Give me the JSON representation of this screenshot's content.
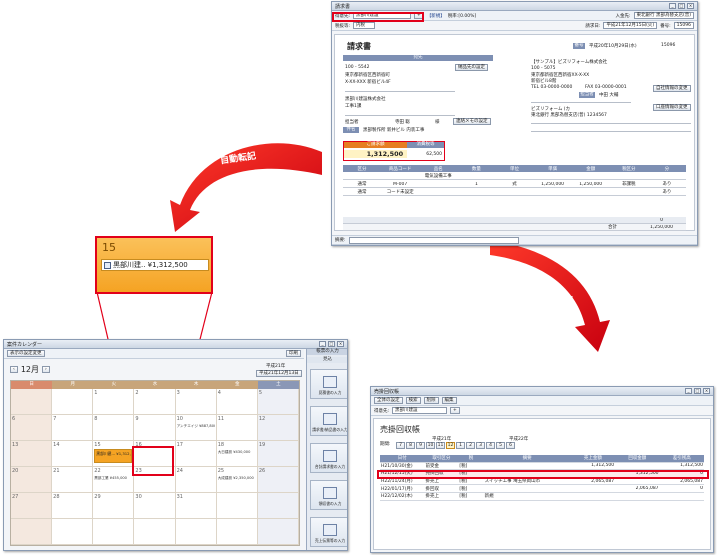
{
  "arrow_label": "自動転記",
  "colors": {
    "accent_red": "#e2001a",
    "header_blue": "#7d8fb3",
    "calendar_orange": "#f5a323"
  },
  "invoice": {
    "window_title": "請求書",
    "client_label": "得意先:",
    "client_value": "黒部川建設",
    "mode": "【新規】",
    "tax_rate": "税率:[0.00%]",
    "sales_label": "入金先:",
    "sales_value": "東北銀行 黒部為替支店(普)",
    "tax_class_label": "税抜等:",
    "tax_class_value": "内税",
    "issue_label": "請求日:",
    "issue_value": "平成21年12月15日(火)",
    "page_label": "番号:",
    "page_value": "15096",
    "doc_title": "請求書",
    "recipient_header": "宛先",
    "delivery_btn": "納品先の設定",
    "postcode": "100 - 5542",
    "address1": "東京都新宿区西新宿町",
    "address2": "X-XX-XXX 新宿ビル4F",
    "company": "黒部川建設株式会社",
    "dept": "工事1課",
    "person_label": "担当者",
    "person_value": "寺田 聡",
    "honorific": "様",
    "memo_btn": "連絡メモの設定",
    "case_label": "件名",
    "case_value": "黒部製作所 新井ビル 内装工事",
    "issuer_number_label": "番号",
    "issuer_number": "15096",
    "issuer_date": "平成20年10月29日(水)",
    "issuer_name": "【サンプル】ビズリフォーム株式会社",
    "issuer_postcode": "100 - 5075",
    "issuer_address1": "東京都新宿区西新宿XX-X-XX",
    "issuer_address2": "新宿ビル8階",
    "issuer_tel": "TEL 03-0000-0000",
    "issuer_fax": "FAX 03-0000-0001",
    "issuer_staff_label": "担当者",
    "issuer_staff": "中田 大輔",
    "seal_btn": "自社情報の変更",
    "bank_btn": "口座情報の変更",
    "bank_name": "ビズリフォーム (カ",
    "bank_detail": "東北銀行 黒部為替支店(普) 1234567",
    "total_header": "ご請求額",
    "tax_header": "消費税等",
    "total_value": "1,312,500",
    "tax_value": "62,500",
    "columns": [
      "区分",
      "商品コード",
      "品名",
      "数量",
      "単位",
      "単価",
      "金額",
      "税区分",
      "分"
    ],
    "rows": [
      [
        "",
        "",
        "電気設備工事",
        "",
        "",
        "",
        "",
        "",
        ""
      ],
      [
        "通常",
        "M-007",
        "",
        "1",
        "式",
        "1,250,000",
        "1,250,000",
        "非課税",
        "あり"
      ],
      [
        "通常",
        "コード未設定",
        "",
        "",
        "",
        "",
        "",
        "",
        "あり"
      ]
    ],
    "subtotal_value": "0",
    "total_footer_label": "合計",
    "total_footer_value": "1,250,000",
    "footer_label": "摘要:"
  },
  "calendar": {
    "window_title": "案件カレンダー",
    "menu": "表示の設定変更",
    "month": "12月",
    "year": "平成21年",
    "today_btn": "平成21年12月13日",
    "weekdays": [
      "日",
      "月",
      "火",
      "水",
      "木",
      "金",
      "土"
    ],
    "days": [
      [
        "",
        "",
        "1",
        "2",
        "3",
        "4",
        "5"
      ],
      [
        "6",
        "7",
        "8",
        "9",
        "10",
        "11",
        "12"
      ],
      [
        "13",
        "14",
        "15",
        "16",
        "17",
        "18",
        "19"
      ],
      [
        "20",
        "21",
        "22",
        "23",
        "24",
        "25",
        "26"
      ],
      [
        "27",
        "28",
        "29",
        "30",
        "31",
        "",
        ""
      ],
      [
        "",
        "",
        "",
        "",
        "",
        "",
        ""
      ]
    ],
    "event_day": "15",
    "event_text": "黒部川建... ¥1,312,500",
    "zoom_day": "15",
    "zoom_text": "黒部川建.. ¥1,312,500",
    "events_small": [
      {
        "day": "10",
        "text": "アンチエイジ ¥887,800"
      },
      {
        "day": "18",
        "text": "大日建設 ¥430,000"
      },
      {
        "day": "22",
        "text": "黒部工業 ¥455,000"
      },
      {
        "day": "25",
        "text": "大成建設 ¥2,350,000"
      }
    ],
    "side_title": "帳票の入力",
    "side_header": "見込",
    "side_buttons": [
      "見積書の入力",
      "請求書/納品書の入力",
      "合計請求書の入力",
      "領収書の入力",
      "売上伝票等の入力"
    ],
    "print_label": "印刷",
    "status": "JPB"
  },
  "collections": {
    "window_title": "売掛回収帳",
    "tool_items": [
      "全体の設定",
      "検索",
      "削除",
      "編集"
    ],
    "client_label": "得意先:",
    "client_value": "黒部川建設",
    "doc_title": "売掛回収帳",
    "period_label": "期間:",
    "year_a": "平成21年",
    "year_b": "平成22年",
    "months": [
      "7",
      "8",
      "9",
      "10",
      "11",
      "12",
      "1",
      "2",
      "3",
      "4",
      "5",
      "6"
    ],
    "columns": [
      "日付",
      "取引区分",
      "税",
      "摘要",
      "売上金額",
      "回収金額",
      "差引残高"
    ],
    "rows": [
      [
        "H21/10/30(金)",
        "前受金",
        "[税]",
        "",
        "1,312,500",
        "",
        "1,312,500"
      ],
      [
        "H21/12/15(火)",
        "売掛回収",
        "[税]",
        "",
        "",
        "1,312,500",
        "0"
      ],
      [
        "H22/11/24(月)",
        "掛売上",
        "[税]",
        "スイッチ工事 埼玉県岡山市",
        "2,065,087",
        "",
        "2,065,087"
      ],
      [
        "H22/01/17(月)",
        "掛回収",
        "[税]",
        "",
        "",
        "2,065,087",
        "0"
      ],
      [
        "H22/12/02(木)",
        "掛売上",
        "[税]",
        "新規",
        "",
        "",
        ""
      ]
    ]
  }
}
